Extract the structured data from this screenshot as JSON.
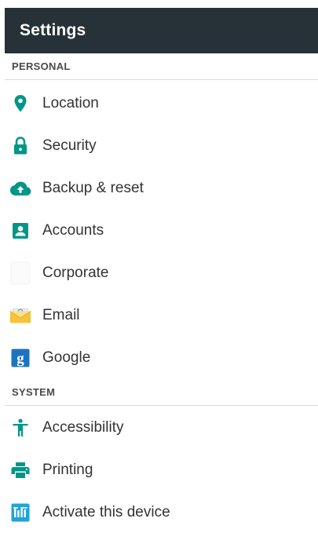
{
  "app_bar": {
    "title": "Settings"
  },
  "sections": {
    "personal": {
      "header": "PERSONAL",
      "items": [
        {
          "label": "Location",
          "icon": "location-pin-icon"
        },
        {
          "label": "Security",
          "icon": "lock-icon"
        },
        {
          "label": "Backup & reset",
          "icon": "cloud-upload-icon"
        },
        {
          "label": "Accounts",
          "icon": "account-box-icon"
        },
        {
          "label": "Corporate",
          "icon": "corporate-icon"
        },
        {
          "label": "Email",
          "icon": "email-envelope-icon"
        },
        {
          "label": "Google",
          "icon": "google-g-icon"
        }
      ]
    },
    "system": {
      "header": "SYSTEM",
      "items": [
        {
          "label": "Accessibility",
          "icon": "accessibility-icon"
        },
        {
          "label": "Printing",
          "icon": "printer-icon"
        },
        {
          "label": "Activate this device",
          "icon": "activate-device-icon"
        }
      ]
    }
  },
  "colors": {
    "app_bar_bg": "#263238",
    "icon_teal": "#009688",
    "google_blue": "#1e73be",
    "email_yellow": "#f7c23c"
  }
}
